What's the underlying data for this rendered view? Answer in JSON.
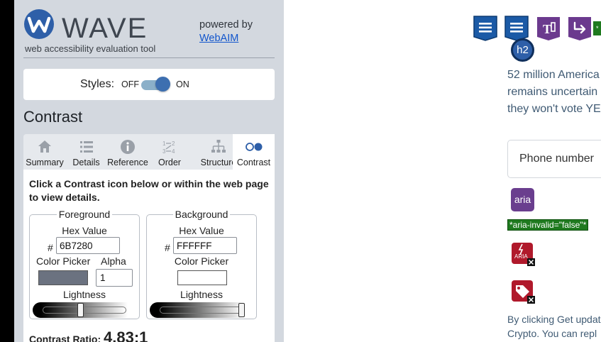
{
  "wave": {
    "brand_name": "WAVE",
    "tagline": "web accessibility evaluation tool",
    "powered_by": "powered by",
    "webaim_link": "WebAIM",
    "styles_label": "Styles:",
    "styles_off": "OFF",
    "styles_on": "ON",
    "styles_on_state": true,
    "panel_heading": "Contrast",
    "tabs": [
      {
        "label": "Summary",
        "icon": "home-icon",
        "active": false
      },
      {
        "label": "Details",
        "icon": "list-icon",
        "active": false
      },
      {
        "label": "Reference",
        "icon": "info-icon",
        "active": false
      },
      {
        "label": "Order",
        "icon": "order-icon",
        "active": false
      },
      {
        "label": "Structure",
        "icon": "structure-icon",
        "active": false
      },
      {
        "label": "Contrast",
        "icon": "contrast-icon",
        "active": true
      }
    ],
    "instructions": "Click a Contrast icon below or within the web page to view details.",
    "foreground": {
      "legend": "Foreground",
      "hex_label": "Hex Value",
      "hash": "#",
      "hex_value": "6B7280",
      "picker_label": "Color Picker",
      "alpha_label": "Alpha",
      "alpha_value": "1",
      "swatch_color": "#6B7280",
      "lightness_label": "Lightness",
      "lightness": 0.45
    },
    "background": {
      "legend": "Background",
      "hex_label": "Hex Value",
      "hash": "#",
      "hex_value": "FFFFFF",
      "picker_label": "Color Picker",
      "swatch_color": "#FFFFFF",
      "lightness_label": "Lightness",
      "lightness": 1.0
    },
    "contrast_ratio_label": "Contrast Ratio:",
    "contrast_ratio_value": "4.83:1"
  },
  "page": {
    "toolbar_icons": [
      "css-list-icon",
      "css-list-icon",
      "text-transform-icon",
      "skip-arrow-icon",
      "tag-icon"
    ],
    "h2_badge": "h2",
    "body_lines": [
      "52 million America",
      "remains uncertain",
      "they won't vote YE"
    ],
    "phone_placeholder": "Phone number",
    "aria_badge": "aria",
    "aria_invalid": "*aria-invalid=\"false\"*",
    "aria_error_label": "ARIA",
    "bottom_lines": [
      "By clicking Get updat",
      "Crypto. You can repl"
    ]
  },
  "colors": {
    "panel_bg": "#d3d8df",
    "accent_blue": "#2e5fa8",
    "aria_purple": "#6a3e8e",
    "error_red": "#b0192b",
    "success_green": "#1f7a1f"
  }
}
